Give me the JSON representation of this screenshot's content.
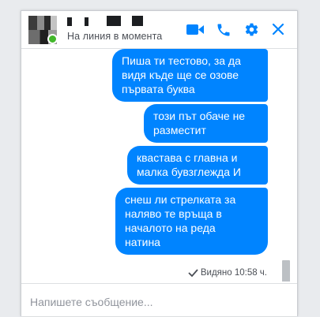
{
  "header": {
    "status": "На линия в момента",
    "icons": [
      "video-camera-icon",
      "phone-icon",
      "gear-icon",
      "close-icon"
    ]
  },
  "messages": [
    {
      "text": "Пиша ти тестово, за да\nвидя къде ще се озове\nпървата буква"
    },
    {
      "text": "този път обаче не\nразместит"
    },
    {
      "text": "квастава с главна и\nмалка бувзглежда И"
    },
    {
      "text": "снеш ли стрелката за\nналяво те връща в\nначалото на реда\nнатина"
    }
  ],
  "seen_status": "Видяно 10:58 ч.",
  "composer": {
    "placeholder": "Напишете съобщение..."
  },
  "colors": {
    "accent": "#0084ff",
    "presence": "#42b72a"
  }
}
